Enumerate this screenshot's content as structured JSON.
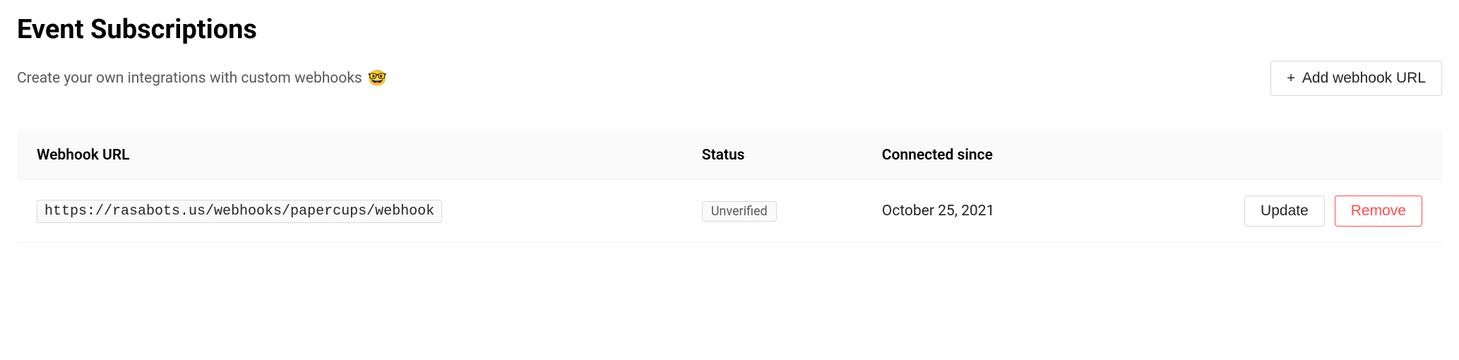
{
  "header": {
    "title": "Event Subscriptions",
    "subtitle": "Create your own integrations with custom webhooks",
    "emoji": "🤓",
    "add_button_label": "Add webhook URL"
  },
  "table": {
    "columns": {
      "url": "Webhook URL",
      "status": "Status",
      "connected": "Connected since"
    },
    "rows": [
      {
        "url": "https://rasabots.us/webhooks/papercups/webhook",
        "status": "Unverified",
        "connected_since": "October 25, 2021",
        "update_label": "Update",
        "remove_label": "Remove"
      }
    ]
  }
}
